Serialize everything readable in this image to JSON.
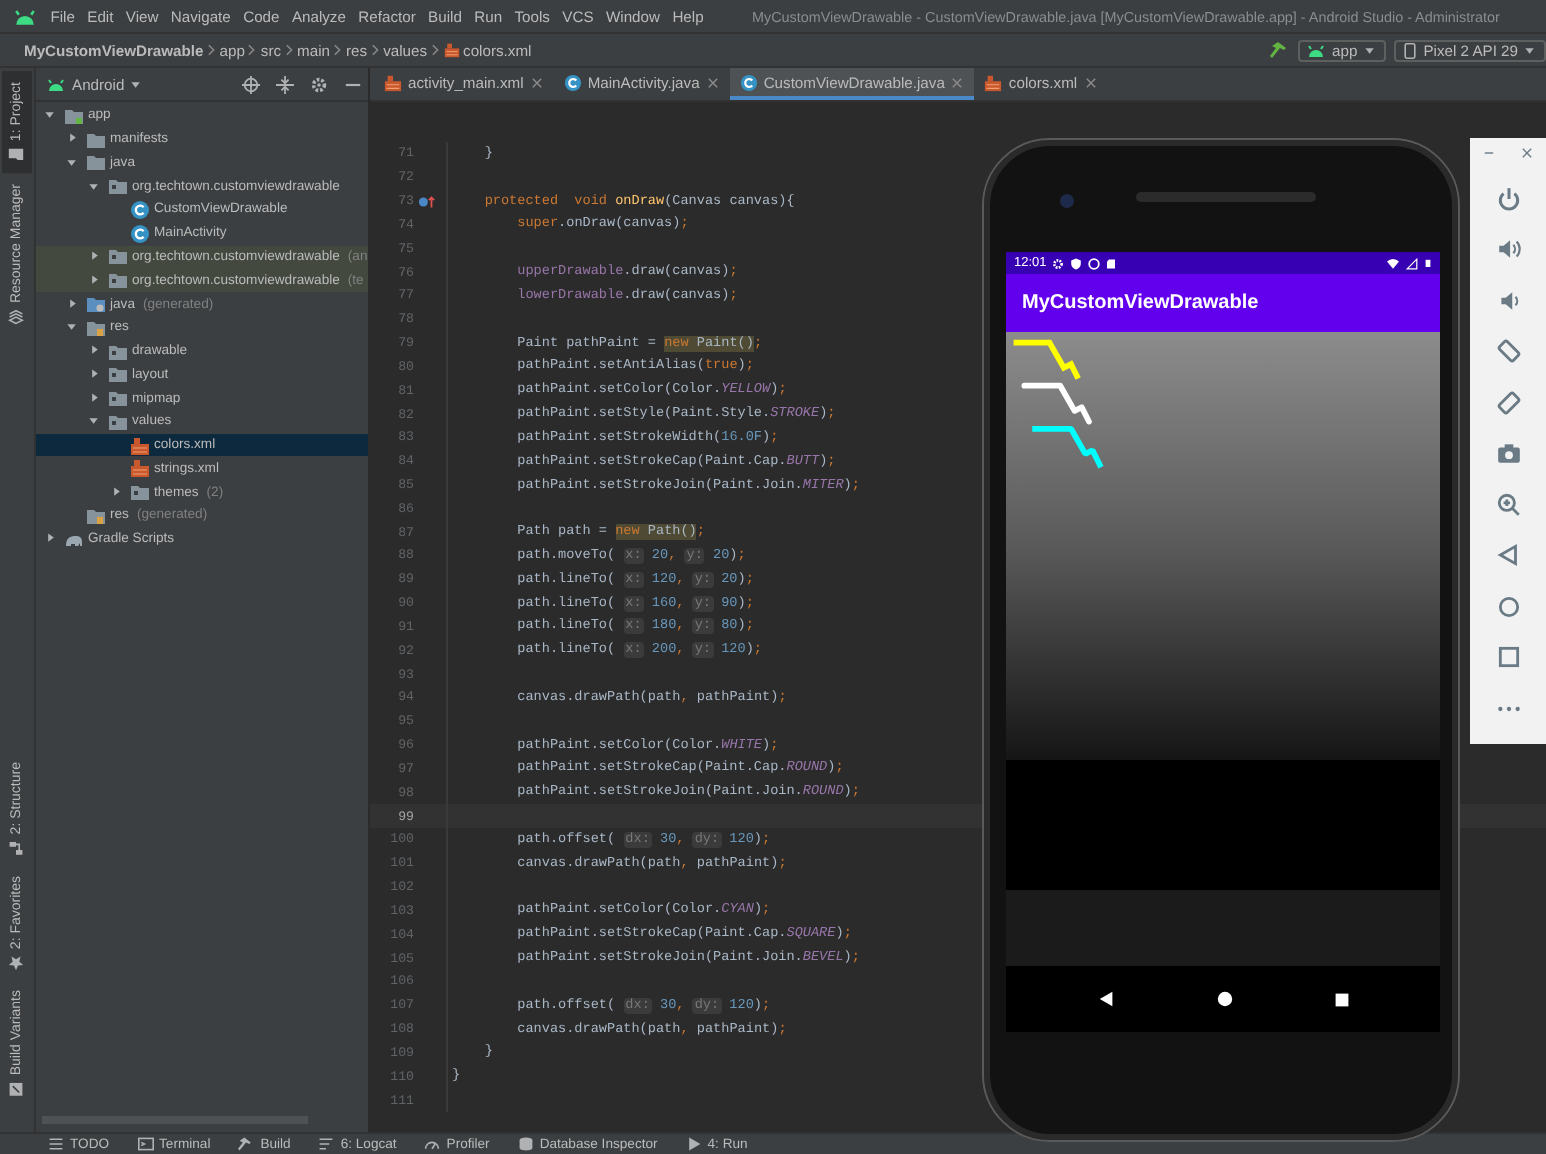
{
  "menu_bar": {
    "items": [
      "File",
      "Edit",
      "View",
      "Navigate",
      "Code",
      "Analyze",
      "Refactor",
      "Build",
      "Run",
      "Tools",
      "VCS",
      "Window",
      "Help"
    ],
    "window_title": "MyCustomViewDrawable - CustomViewDrawable.java [MyCustomViewDrawable.app] - Android Studio - Administrator"
  },
  "nav_bar": {
    "breadcrumbs": [
      "MyCustomViewDrawable",
      "app",
      "src",
      "main",
      "res",
      "values",
      "colors.xml"
    ],
    "run_config": "app",
    "device": "Pixel 2 API 29"
  },
  "tool_strip": {
    "top": [
      {
        "label": "1: Project",
        "kind": "folder",
        "selected": true
      },
      {
        "label": "Resource Manager",
        "kind": "layers",
        "selected": false
      }
    ],
    "bottom": [
      {
        "label": "2: Structure",
        "kind": "structure",
        "selected": false
      },
      {
        "label": "2: Favorites",
        "kind": "star",
        "selected": false
      },
      {
        "label": "Build Variants",
        "kind": "variants",
        "selected": false
      }
    ]
  },
  "project": {
    "view": "Android",
    "tree": [
      {
        "label": "app",
        "kind": "module",
        "expanded": true,
        "selected": false,
        "children": [
          {
            "label": "manifests",
            "kind": "folder",
            "expanded": false,
            "selected": false
          },
          {
            "label": "java",
            "kind": "folder",
            "expanded": true,
            "selected": false,
            "children": [
              {
                "label": "org.techtown.customviewdrawable",
                "kind": "package",
                "expanded": true,
                "selected": false,
                "children": [
                  {
                    "label": "CustomViewDrawable",
                    "kind": "class",
                    "selected": false
                  },
                  {
                    "label": "MainActivity",
                    "kind": "class",
                    "selected": false
                  }
                ]
              },
              {
                "label": "org.techtown.customviewdrawable",
                "suffix": "(an",
                "kind": "package",
                "expanded": false,
                "selected": false,
                "highlighted": true
              },
              {
                "label": "org.techtown.customviewdrawable",
                "suffix": "(te",
                "kind": "package",
                "expanded": false,
                "selected": false,
                "highlighted": true
              }
            ]
          },
          {
            "label": "java",
            "suffix": "(generated)",
            "kind": "genfolder",
            "expanded": false,
            "selected": false
          },
          {
            "label": "res",
            "kind": "resfolder",
            "expanded": true,
            "selected": false,
            "children": [
              {
                "label": "drawable",
                "kind": "package",
                "expanded": false,
                "selected": false
              },
              {
                "label": "layout",
                "kind": "package",
                "expanded": false,
                "selected": false
              },
              {
                "label": "mipmap",
                "kind": "package",
                "expanded": false,
                "selected": false
              },
              {
                "label": "values",
                "kind": "package",
                "expanded": true,
                "selected": false,
                "children": [
                  {
                    "label": "colors.xml",
                    "kind": "xml",
                    "selected": true
                  },
                  {
                    "label": "strings.xml",
                    "kind": "xml",
                    "selected": false
                  },
                  {
                    "label": "themes",
                    "suffix": "(2)",
                    "kind": "package",
                    "expanded": false,
                    "selected": false
                  }
                ]
              }
            ]
          },
          {
            "label": "res",
            "suffix": "(generated)",
            "kind": "resfolder",
            "selected": false
          }
        ]
      },
      {
        "label": "Gradle Scripts",
        "kind": "gradle",
        "expanded": false,
        "selected": false
      }
    ]
  },
  "editor": {
    "tabs": [
      {
        "label": "activity_main.xml",
        "kind": "xml",
        "selected": false
      },
      {
        "label": "MainActivity.java",
        "kind": "class",
        "selected": false
      },
      {
        "label": "CustomViewDrawable.java",
        "kind": "class",
        "selected": true
      },
      {
        "label": "colors.xml",
        "kind": "xml",
        "selected": false
      }
    ],
    "lines": [
      {
        "n": "71",
        "tokens": [
          {
            "kind": "p",
            "text": "    }"
          }
        ]
      },
      {
        "n": "72"
      },
      {
        "n": "73",
        "override": true,
        "tokens": [
          {
            "kind": "kw",
            "text": "    protected  void "
          },
          {
            "kind": "fn",
            "text": "onDraw"
          },
          {
            "kind": "p",
            "text": "(Canvas canvas){"
          }
        ]
      },
      {
        "n": "74",
        "tokens": [
          {
            "kind": "kw",
            "text": "        super"
          },
          {
            "kind": "p",
            "text": ".onDraw(canvas)"
          },
          {
            "kind": "kw",
            "text": ";"
          }
        ]
      },
      {
        "n": "75"
      },
      {
        "n": "76",
        "tokens": [
          {
            "kind": "fld",
            "text": "        upperDrawable"
          },
          {
            "kind": "p",
            "text": ".draw(canvas)"
          },
          {
            "kind": "kw",
            "text": ";"
          }
        ]
      },
      {
        "n": "77",
        "tokens": [
          {
            "kind": "fld",
            "text": "        lowerDrawable"
          },
          {
            "kind": "p",
            "text": ".draw(canvas)"
          },
          {
            "kind": "kw",
            "text": ";"
          }
        ]
      },
      {
        "n": "78"
      },
      {
        "n": "79",
        "tokens": [
          {
            "kind": "p",
            "text": "        Paint pathPaint = "
          },
          {
            "kind": "kwhl",
            "text": "new "
          },
          {
            "kind": "phl",
            "text": "Paint()"
          },
          {
            "kind": "kw",
            "text": ";"
          }
        ]
      },
      {
        "n": "80",
        "tokens": [
          {
            "kind": "p",
            "text": "        pathPaint.setAntiAlias("
          },
          {
            "kind": "kw",
            "text": "true"
          },
          {
            "kind": "p",
            "text": ")"
          },
          {
            "kind": "kw",
            "text": ";"
          }
        ]
      },
      {
        "n": "81",
        "tokens": [
          {
            "kind": "p",
            "text": "        pathPaint.setColor(Color."
          },
          {
            "kind": "cst",
            "text": "YELLOW"
          },
          {
            "kind": "p",
            "text": ")"
          },
          {
            "kind": "kw",
            "text": ";"
          }
        ]
      },
      {
        "n": "82",
        "tokens": [
          {
            "kind": "p",
            "text": "        pathPaint.setStyle(Paint.Style."
          },
          {
            "kind": "cst",
            "text": "STROKE"
          },
          {
            "kind": "p",
            "text": ")"
          },
          {
            "kind": "kw",
            "text": ";"
          }
        ]
      },
      {
        "n": "83",
        "tokens": [
          {
            "kind": "p",
            "text": "        pathPaint.setStrokeWidth("
          },
          {
            "kind": "num",
            "text": "16.0F"
          },
          {
            "kind": "p",
            "text": ")"
          },
          {
            "kind": "kw",
            "text": ";"
          }
        ]
      },
      {
        "n": "84",
        "tokens": [
          {
            "kind": "p",
            "text": "        pathPaint.setStrokeCap(Paint.Cap."
          },
          {
            "kind": "cst",
            "text": "BUTT"
          },
          {
            "kind": "p",
            "text": ")"
          },
          {
            "kind": "kw",
            "text": ";"
          }
        ]
      },
      {
        "n": "85",
        "tokens": [
          {
            "kind": "p",
            "text": "        pathPaint.setStrokeJoin(Paint.Join."
          },
          {
            "kind": "cst",
            "text": "MITER"
          },
          {
            "kind": "p",
            "text": ")"
          },
          {
            "kind": "kw",
            "text": ";"
          }
        ]
      },
      {
        "n": "86"
      },
      {
        "n": "87",
        "tokens": [
          {
            "kind": "p",
            "text": "        Path path = "
          },
          {
            "kind": "kwhl",
            "text": "new "
          },
          {
            "kind": "phl",
            "text": "Path()"
          },
          {
            "kind": "kw",
            "text": ";"
          }
        ]
      },
      {
        "n": "88",
        "tokens": [
          {
            "kind": "p",
            "text": "        path.moveTo( "
          },
          {
            "kind": "hint",
            "text": "x:"
          },
          {
            "kind": "num",
            "text": " 20"
          },
          {
            "kind": "kw",
            "text": ", "
          },
          {
            "kind": "hint",
            "text": "y:"
          },
          {
            "kind": "num",
            "text": " 20"
          },
          {
            "kind": "p",
            "text": ")"
          },
          {
            "kind": "kw",
            "text": ";"
          }
        ]
      },
      {
        "n": "89",
        "tokens": [
          {
            "kind": "p",
            "text": "        path.lineTo( "
          },
          {
            "kind": "hint",
            "text": "x:"
          },
          {
            "kind": "num",
            "text": " 120"
          },
          {
            "kind": "kw",
            "text": ", "
          },
          {
            "kind": "hint",
            "text": "y:"
          },
          {
            "kind": "num",
            "text": " 20"
          },
          {
            "kind": "p",
            "text": ")"
          },
          {
            "kind": "kw",
            "text": ";"
          }
        ]
      },
      {
        "n": "90",
        "tokens": [
          {
            "kind": "p",
            "text": "        path.lineTo( "
          },
          {
            "kind": "hint",
            "text": "x:"
          },
          {
            "kind": "num",
            "text": " 160"
          },
          {
            "kind": "kw",
            "text": ", "
          },
          {
            "kind": "hint",
            "text": "y:"
          },
          {
            "kind": "num",
            "text": " 90"
          },
          {
            "kind": "p",
            "text": ")"
          },
          {
            "kind": "kw",
            "text": ";"
          }
        ]
      },
      {
        "n": "91",
        "tokens": [
          {
            "kind": "p",
            "text": "        path.lineTo( "
          },
          {
            "kind": "hint",
            "text": "x:"
          },
          {
            "kind": "num",
            "text": " 180"
          },
          {
            "kind": "kw",
            "text": ", "
          },
          {
            "kind": "hint",
            "text": "y:"
          },
          {
            "kind": "num",
            "text": " 80"
          },
          {
            "kind": "p",
            "text": ")"
          },
          {
            "kind": "kw",
            "text": ";"
          }
        ]
      },
      {
        "n": "92",
        "tokens": [
          {
            "kind": "p",
            "text": "        path.lineTo( "
          },
          {
            "kind": "hint",
            "text": "x:"
          },
          {
            "kind": "num",
            "text": " 200"
          },
          {
            "kind": "kw",
            "text": ", "
          },
          {
            "kind": "hint",
            "text": "y:"
          },
          {
            "kind": "num",
            "text": " 120"
          },
          {
            "kind": "p",
            "text": ")"
          },
          {
            "kind": "kw",
            "text": ";"
          }
        ]
      },
      {
        "n": "93"
      },
      {
        "n": "94",
        "tokens": [
          {
            "kind": "p",
            "text": "        canvas.drawPath(path"
          },
          {
            "kind": "kw",
            "text": ", "
          },
          {
            "kind": "p",
            "text": "pathPaint)"
          },
          {
            "kind": "kw",
            "text": ";"
          }
        ]
      },
      {
        "n": "95"
      },
      {
        "n": "96",
        "tokens": [
          {
            "kind": "p",
            "text": "        pathPaint.setColor(Color."
          },
          {
            "kind": "cst",
            "text": "WHITE"
          },
          {
            "kind": "p",
            "text": ")"
          },
          {
            "kind": "kw",
            "text": ";"
          }
        ]
      },
      {
        "n": "97",
        "tokens": [
          {
            "kind": "p",
            "text": "        pathPaint.setStrokeCap(Paint.Cap."
          },
          {
            "kind": "cst",
            "text": "ROUND"
          },
          {
            "kind": "p",
            "text": ")"
          },
          {
            "kind": "kw",
            "text": ";"
          }
        ]
      },
      {
        "n": "98",
        "tokens": [
          {
            "kind": "p",
            "text": "        pathPaint.setStrokeJoin(Paint.Join."
          },
          {
            "kind": "cst",
            "text": "ROUND"
          },
          {
            "kind": "p",
            "text": ")"
          },
          {
            "kind": "kw",
            "text": ";"
          }
        ]
      },
      {
        "n": "99",
        "current": true
      },
      {
        "n": "100",
        "tokens": [
          {
            "kind": "p",
            "text": "        path.offset( "
          },
          {
            "kind": "hint",
            "text": "dx:"
          },
          {
            "kind": "num",
            "text": " 30"
          },
          {
            "kind": "kw",
            "text": ", "
          },
          {
            "kind": "hint",
            "text": "dy:"
          },
          {
            "kind": "num",
            "text": " 120"
          },
          {
            "kind": "p",
            "text": ")"
          },
          {
            "kind": "kw",
            "text": ";"
          }
        ]
      },
      {
        "n": "101",
        "tokens": [
          {
            "kind": "p",
            "text": "        canvas.drawPath(path"
          },
          {
            "kind": "kw",
            "text": ", "
          },
          {
            "kind": "p",
            "text": "pathPaint)"
          },
          {
            "kind": "kw",
            "text": ";"
          }
        ]
      },
      {
        "n": "102"
      },
      {
        "n": "103",
        "tokens": [
          {
            "kind": "p",
            "text": "        pathPaint.setColor(Color."
          },
          {
            "kind": "cst",
            "text": "CYAN"
          },
          {
            "kind": "p",
            "text": ")"
          },
          {
            "kind": "kw",
            "text": ";"
          }
        ]
      },
      {
        "n": "104",
        "tokens": [
          {
            "kind": "p",
            "text": "        pathPaint.setStrokeCap(Paint.Cap."
          },
          {
            "kind": "cst",
            "text": "SQUARE"
          },
          {
            "kind": "p",
            "text": ")"
          },
          {
            "kind": "kw",
            "text": ";"
          }
        ]
      },
      {
        "n": "105",
        "tokens": [
          {
            "kind": "p",
            "text": "        pathPaint.setStrokeJoin(Paint.Join."
          },
          {
            "kind": "cst",
            "text": "BEVEL"
          },
          {
            "kind": "p",
            "text": ")"
          },
          {
            "kind": "kw",
            "text": ";"
          }
        ]
      },
      {
        "n": "106"
      },
      {
        "n": "107",
        "tokens": [
          {
            "kind": "p",
            "text": "        path.offset( "
          },
          {
            "kind": "hint",
            "text": "dx:"
          },
          {
            "kind": "num",
            "text": " 30"
          },
          {
            "kind": "kw",
            "text": ", "
          },
          {
            "kind": "hint",
            "text": "dy:"
          },
          {
            "kind": "num",
            "text": " 120"
          },
          {
            "kind": "p",
            "text": ")"
          },
          {
            "kind": "kw",
            "text": ";"
          }
        ]
      },
      {
        "n": "108",
        "tokens": [
          {
            "kind": "p",
            "text": "        canvas.drawPath(path"
          },
          {
            "kind": "kw",
            "text": ", "
          },
          {
            "kind": "p",
            "text": "pathPaint)"
          },
          {
            "kind": "kw",
            "text": ";"
          }
        ]
      },
      {
        "n": "109",
        "tokens": [
          {
            "kind": "p",
            "text": "    }"
          }
        ]
      },
      {
        "n": "110",
        "tokens": [
          {
            "kind": "p",
            "text": "}"
          }
        ]
      },
      {
        "n": "111"
      }
    ]
  },
  "emulator": {
    "status_time": "12:01",
    "app_title": "MyCustomViewDrawable"
  },
  "bottom_tools": [
    {
      "label": "TODO",
      "kind": "list"
    },
    {
      "label": "Terminal",
      "kind": "terminal"
    },
    {
      "label": "Build",
      "kind": "hammer"
    },
    {
      "label": "6: Logcat",
      "kind": "logcat"
    },
    {
      "label": "Profiler",
      "kind": "gauge"
    },
    {
      "label": "Database Inspector",
      "kind": "database"
    },
    {
      "label": "4: Run",
      "kind": "play"
    }
  ]
}
